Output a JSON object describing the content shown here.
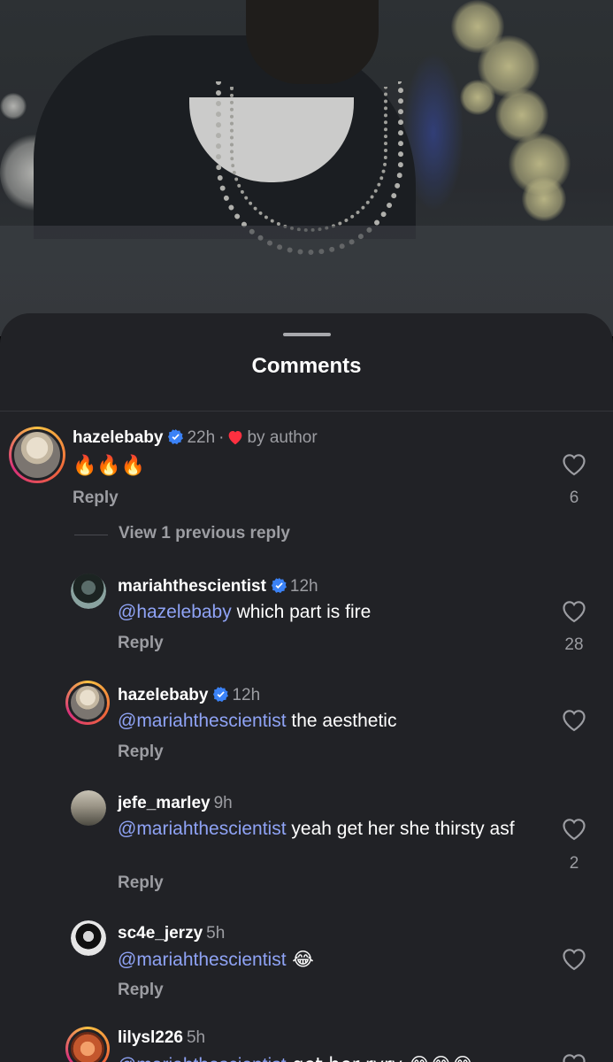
{
  "sheet": {
    "title": "Comments"
  },
  "comments": [
    {
      "username": "hazelebaby",
      "time": "22h",
      "separator": "·",
      "liked_by_author": "by author",
      "text": "🔥🔥🔥",
      "reply": "Reply",
      "likes": "6",
      "view_previous": "View 1 previous reply"
    },
    {
      "username": "mariahthescientist",
      "time": "12h",
      "mention": "@hazelebaby",
      "text": " which part is fire",
      "reply": "Reply",
      "likes": "28"
    },
    {
      "username": "hazelebaby",
      "time": "12h",
      "mention": "@mariahthescientist",
      "text": " the aesthetic",
      "reply": "Reply",
      "likes": ""
    },
    {
      "username": "jefe_marley",
      "time": "9h",
      "mention": "@mariahthescientist",
      "text": " yeah get her she thirsty asf",
      "reply": "Reply",
      "likes": "2"
    },
    {
      "username": "sc4e_jerzy",
      "time": "5h",
      "mention": "@mariahthescientist",
      "text": " 😂",
      "reply": "Reply",
      "likes": ""
    },
    {
      "username": "lilysl226",
      "time": "5h",
      "mention": "@mariahthescientist",
      "text": " get her ryry 😂😂😂"
    }
  ],
  "colors": {
    "sheet_bg": "#212226",
    "mention": "#8fa3f5",
    "secondary_text": "#9c9da2",
    "verified": "#3b82f6",
    "heart": "#ff3040"
  }
}
